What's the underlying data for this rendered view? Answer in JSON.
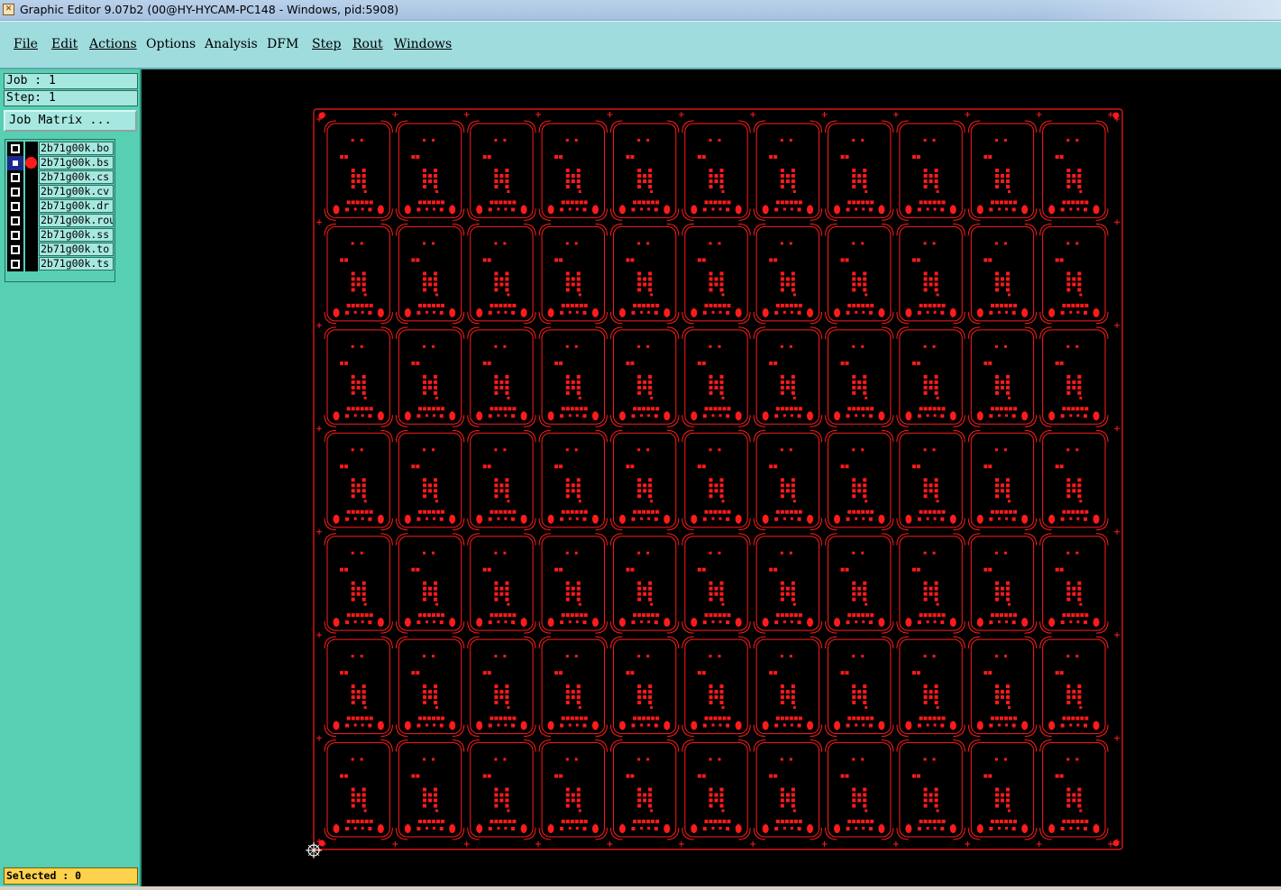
{
  "window": {
    "title": "Graphic Editor 9.07b2 (00@HY-HYCAM-PC148 - Windows, pid:5908)"
  },
  "menu": [
    {
      "label": "File"
    },
    {
      "label": "Edit"
    },
    {
      "label": "Actions"
    },
    {
      "label": "Options"
    },
    {
      "label": "Analysis"
    },
    {
      "label": "DFM"
    },
    {
      "label": "Step"
    },
    {
      "label": "Rout"
    },
    {
      "label": "Windows"
    }
  ],
  "job": {
    "text": "Job : 1"
  },
  "step": {
    "text": "Step: 1"
  },
  "job_matrix_button": {
    "label": "Job Matrix ..."
  },
  "layers": [
    {
      "name": "2b71g00k.bo",
      "active": false
    },
    {
      "name": "2b71g00k.bs",
      "active": true
    },
    {
      "name": "2b71g00k.cs",
      "active": false
    },
    {
      "name": "2b71g00k.cv",
      "active": false
    },
    {
      "name": "2b71g00k.dr",
      "active": false
    },
    {
      "name": "2b71g00k.rou",
      "active": false
    },
    {
      "name": "2b71g00k.ss",
      "active": false
    },
    {
      "name": "2b71g00k.to",
      "active": false
    },
    {
      "name": "2b71g00k.ts",
      "active": false
    }
  ],
  "status": {
    "selected": "Selected : 0"
  },
  "canvas": {
    "layer_color": "#ff1b1b",
    "background": "#000000",
    "array": {
      "columns": 11,
      "rows": 7
    }
  }
}
